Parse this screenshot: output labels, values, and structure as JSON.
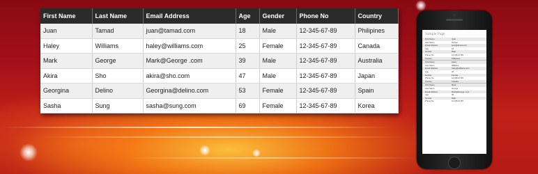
{
  "table": {
    "headers": [
      "First Name",
      "Last Name",
      "Email Address",
      "Age",
      "Gender",
      "Phone No",
      "Country"
    ],
    "rows": [
      [
        "Juan",
        "Tamad",
        "juan@tamad.com",
        "18",
        "Male",
        "12-345-67-89",
        "Philipines"
      ],
      [
        "Haley",
        "Williams",
        "haley@williams.com",
        "25",
        "Female",
        "12-345-67-89",
        "Canada"
      ],
      [
        "Mark",
        "George",
        "Mark@George .com",
        "39",
        "Male",
        "12-345-67-89",
        "Australia"
      ],
      [
        "Akira",
        "Sho",
        "akira@sho.com",
        "47",
        "Male",
        "12-345-67-89",
        "Japan"
      ],
      [
        "Georgina",
        "Delino",
        "Georgina@delino.com",
        "53",
        "Female",
        "12-345-67-89",
        "Spain"
      ],
      [
        "Sasha",
        "Sung",
        "sasha@sung.com",
        "69",
        "Female",
        "12-345-67-89",
        "Korea"
      ]
    ]
  },
  "phone": {
    "title": "Sample Page",
    "records": [
      [
        [
          "First Name",
          "Juan"
        ],
        [
          "Last Name",
          "Tamad"
        ],
        [
          "Email Address",
          "juan@tamad.com"
        ],
        [
          "Age",
          "18"
        ],
        [
          "Gender",
          "Male"
        ],
        [
          "Phone No",
          "12-345-67-89"
        ],
        [
          "Country",
          "Philipines"
        ]
      ],
      [
        [
          "First Name",
          "Haley"
        ],
        [
          "Last Name",
          "Williams"
        ],
        [
          "Email Address",
          "haley@williams.com"
        ],
        [
          "Age",
          "25"
        ],
        [
          "Gender",
          "Female"
        ],
        [
          "Phone No",
          "12-345-67-89"
        ],
        [
          "Country",
          "Canada"
        ]
      ],
      [
        [
          "First Name",
          "Mark"
        ],
        [
          "Last Name",
          "George"
        ],
        [
          "Email Address",
          "Mark@George .com"
        ],
        [
          "Age",
          "39"
        ],
        [
          "Gender",
          "Male"
        ],
        [
          "Phone No",
          "12-345-67-89"
        ]
      ]
    ]
  }
}
